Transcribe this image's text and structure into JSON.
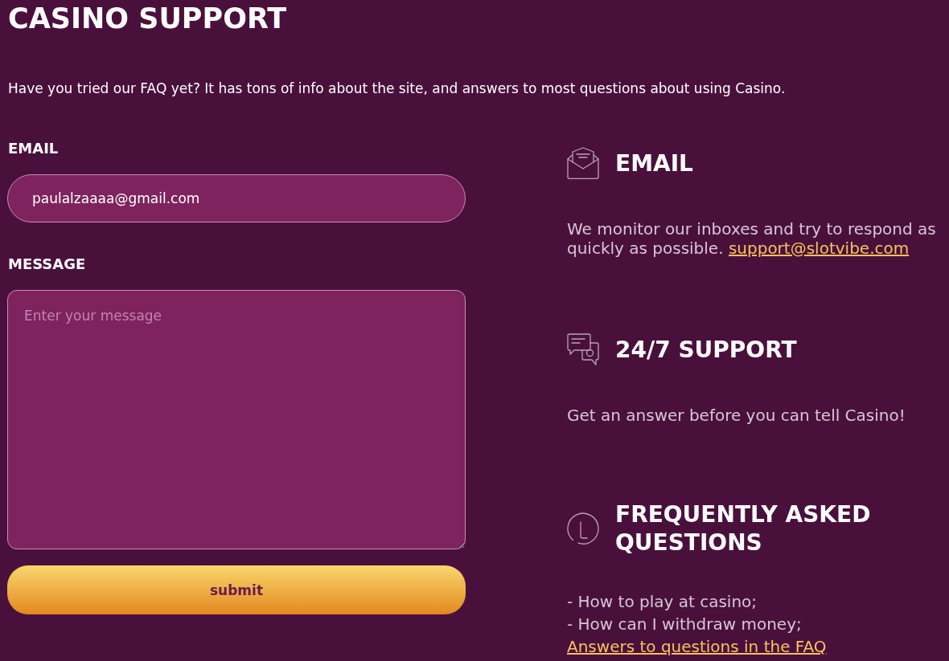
{
  "page": {
    "title": "CASINO SUPPORT",
    "intro": "Have you tried our FAQ yet? It has tons of info about the site, and answers to most questions about using Casino."
  },
  "form": {
    "email": {
      "label": "EMAIL",
      "value": "paulalzaaaa@gmail.com"
    },
    "message": {
      "label": "MESSAGE",
      "placeholder": "Enter your message"
    },
    "submit": "submit"
  },
  "contact_sections": [
    {
      "kind": "email",
      "title": "EMAIL",
      "text": "We monitor our inboxes and try to respond as quickly as possible.",
      "link": "support@slotvibe.com"
    },
    {
      "kind": "chat",
      "title": "24/7 SUPPORT",
      "text": "Get an answer before you can tell Casino!"
    },
    {
      "kind": "faq",
      "title": "FREQUENTLY ASKED QUESTIONS",
      "lines": [
        "- How to play at casino;",
        "- How can I withdraw money;"
      ],
      "link": "Answers to questions in the FAQ"
    }
  ]
}
